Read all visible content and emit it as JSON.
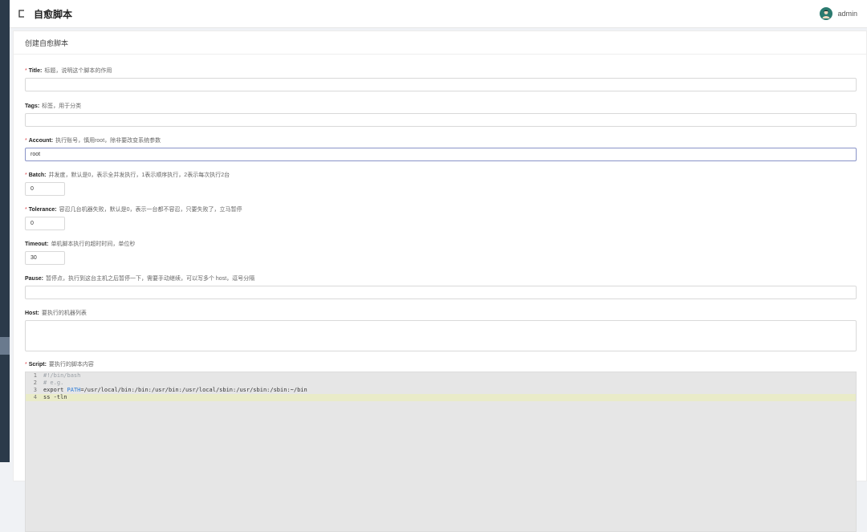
{
  "header": {
    "title": "自愈脚本",
    "username": "admin"
  },
  "card": {
    "title": "创建自愈脚本"
  },
  "form": {
    "title": {
      "name": "Title:",
      "desc": "标题，说明这个脚本的作用",
      "required": true,
      "value": ""
    },
    "tags": {
      "name": "Tags:",
      "desc": "标签，用于分类",
      "required": false,
      "value": ""
    },
    "account": {
      "name": "Account:",
      "desc": "执行账号，慎用root，除非要改变系统参数",
      "required": true,
      "value": "root"
    },
    "batch": {
      "name": "Batch:",
      "desc": "并发度，默认是0，表示全并发执行，1表示顺序执行，2表示每次执行2台",
      "required": true,
      "value": "0"
    },
    "tolerance": {
      "name": "Tolerance:",
      "desc": "容忍几台机器失败，默认是0，表示一台都不容忍，只要失败了，立马暂停",
      "required": true,
      "value": "0"
    },
    "timeout": {
      "name": "Timeout:",
      "desc": "单机脚本执行的超时时间，单位秒",
      "required": false,
      "value": "30"
    },
    "pause": {
      "name": "Pause:",
      "desc": "暂停点，执行到这台主机之后暂停一下，需要手动继续，可以写多个 host，逗号分隔",
      "required": false,
      "value": ""
    },
    "host": {
      "name": "Host:",
      "desc": "要执行的机器列表",
      "required": false,
      "value": ""
    },
    "script": {
      "name": "Script:",
      "desc": "要执行的脚本内容",
      "required": true,
      "lines": [
        {
          "no": "1",
          "parts": [
            {
              "t": "#!/bin/bash",
              "k": "comment"
            }
          ]
        },
        {
          "no": "2",
          "parts": [
            {
              "t": "# e.g.",
              "k": "comment"
            }
          ]
        },
        {
          "no": "3",
          "parts": [
            {
              "t": "export ",
              "k": "plain"
            },
            {
              "t": "PATH",
              "k": "var"
            },
            {
              "t": "=/usr/local/bin:/bin:/usr/bin:/usr/local/sbin:/usr/sbin:/sbin:~/bin",
              "k": "plain"
            }
          ]
        },
        {
          "no": "4",
          "parts": [
            {
              "t": "ss -tln",
              "k": "plain"
            }
          ]
        }
      ]
    }
  },
  "colors": {
    "required": "#e0474c",
    "focus_border": "#8a94c8",
    "sidebar": "#2b3a4a",
    "active_line": "#e9ebc8"
  }
}
